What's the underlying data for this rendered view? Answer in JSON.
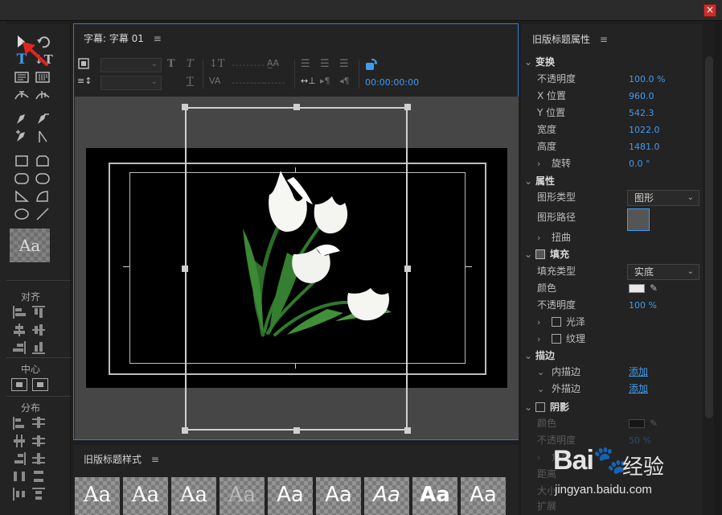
{
  "window": {
    "close_label": "×"
  },
  "tools": {
    "style_sample": "Aa",
    "align_label": "对齐",
    "center_label": "中心",
    "distribute_label": "分布"
  },
  "title_panel": {
    "tab_label": "字幕: 字幕 01",
    "timecode": "00:00:00:00"
  },
  "styles_panel": {
    "title": "旧版标题样式",
    "samples": [
      "Aa",
      "Aa",
      "Aa",
      "Aa",
      "Aa",
      "Aa",
      "Aa",
      "Aa",
      "Aa"
    ]
  },
  "properties": {
    "title": "旧版标题属性",
    "transform": {
      "label": "变换",
      "opacity_label": "不透明度",
      "opacity": "100.0 %",
      "x_label": "X 位置",
      "x": "960.0",
      "y_label": "Y 位置",
      "y": "542.3",
      "width_label": "宽度",
      "width": "1022.0",
      "height_label": "高度",
      "height": "1481.0",
      "rotation_label": "旋转",
      "rotation": "0.0 °"
    },
    "attributes": {
      "label": "属性",
      "graphic_type_label": "图形类型",
      "graphic_type": "图形",
      "graphic_path_label": "图形路径",
      "distort_label": "扭曲"
    },
    "fill": {
      "label": "填充",
      "fill_type_label": "填充类型",
      "fill_type": "实底",
      "color_label": "颜色",
      "color": "#e8e8e8",
      "opacity_label": "不透明度",
      "opacity": "100 %",
      "sheen_label": "光泽",
      "texture_label": "纹理"
    },
    "stroke": {
      "label": "描边",
      "inner_label": "内描边",
      "inner_action": "添加",
      "outer_label": "外描边",
      "outer_action": "添加"
    },
    "shadow": {
      "label": "阴影",
      "color_label": "颜色",
      "color": "#000000",
      "opacity_label": "不透明度",
      "opacity": "50 %",
      "angle_label": "角度",
      "distance_label": "距离",
      "size_label": "大小",
      "spread_label": "扩展"
    }
  },
  "watermark": {
    "logo": "Bai",
    "cn": "经验",
    "url": "jingyan.baidu.com"
  },
  "colors": {
    "accent": "#2d7fd6",
    "value_blue": "#3f9cf0",
    "bg": "#232323"
  }
}
